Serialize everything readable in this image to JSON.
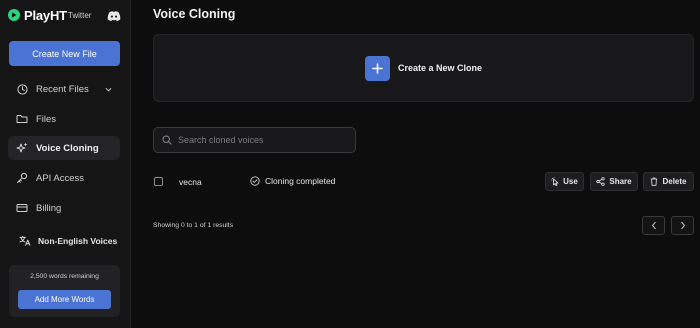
{
  "brand": {
    "name": "PlayHT",
    "twitter_alt": "Twitter"
  },
  "sidebar": {
    "create_label": "Create New File",
    "items": [
      {
        "label": "Recent Files",
        "icon": "clock-icon"
      },
      {
        "label": "Files",
        "icon": "folder-icon"
      },
      {
        "label": "Voice Cloning",
        "icon": "sparkles-icon",
        "active": true
      },
      {
        "label": "API Access",
        "icon": "key-icon"
      },
      {
        "label": "Billing",
        "icon": "credit-card-icon"
      },
      {
        "label": "Non-English Voices",
        "icon": "translate-icon"
      }
    ],
    "words_remaining": "2,500 words remaining",
    "add_words_label": "Add More Words"
  },
  "main": {
    "title": "Voice Cloning",
    "create_clone_label": "Create a New Clone",
    "search_placeholder": "Search cloned voices",
    "rows": [
      {
        "name": "vecna",
        "status": "Cloning completed"
      }
    ],
    "actions": {
      "use": "Use",
      "share": "Share",
      "delete": "Delete"
    },
    "results_text": "Showing 0 to 1 of 1 results"
  },
  "colors": {
    "accent": "#4a73d4",
    "logo_green": "#2bd47e",
    "background": "#0d0d0e",
    "sidebar": "#151516"
  }
}
